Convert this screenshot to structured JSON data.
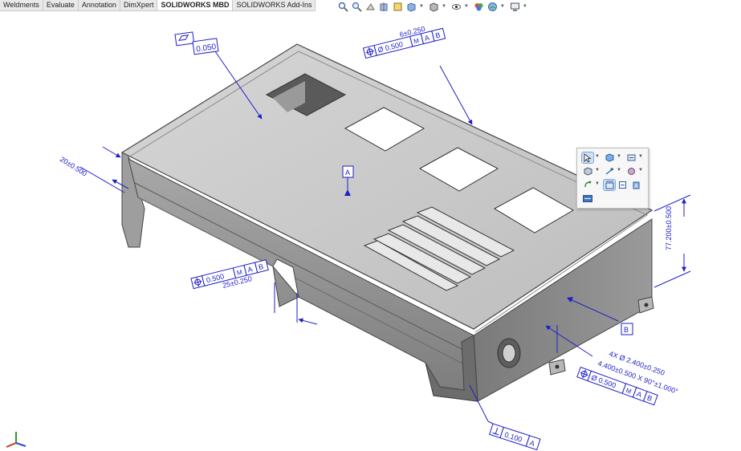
{
  "tabs": [
    {
      "label": "Weldments",
      "active": false
    },
    {
      "label": "Evaluate",
      "active": false
    },
    {
      "label": "Annotation",
      "active": false
    },
    {
      "label": "DimXpert",
      "active": false
    },
    {
      "label": "SOLIDWORKS MBD",
      "active": true
    },
    {
      "label": "SOLIDWORKS Add-Ins",
      "active": false
    }
  ],
  "heads_up_toolbar": [
    "zoom-to-fit-icon",
    "zoom-to-area-icon",
    "previous-view-icon",
    "section-view-icon",
    "dynamic-annotation-icon",
    "view-orientation-icon",
    "display-style-icon",
    "hide-show-items-icon",
    "edit-appearance-icon",
    "apply-scene-icon",
    "view-settings-icon"
  ],
  "annotations": {
    "flatness_tol": "0.050",
    "hole_pattern_qty": "6±0.250",
    "hole_pattern_pos_tol": "Ø 0.500",
    "hole_pattern_mod": "M",
    "hole_pattern_datum1": "A",
    "hole_pattern_datum2": "B",
    "side_dim": "20±0.500",
    "slot_qty": "25±0.250",
    "slot_pos_tol": "0.500",
    "slot_mod": "M",
    "slot_datum1": "A",
    "slot_datum2": "B",
    "height_dim": "77.200±0.500",
    "datum_a": "A",
    "datum_b": "B",
    "side_hole_line1": "4X Ø 2.400±0.250",
    "side_hole_line2": "4.400±0.500 X 90°±1.000°",
    "side_hole_pos_tol": "Ø 0.500",
    "side_hole_mod": "M",
    "side_hole_datum1": "A",
    "side_hole_datum2": "B",
    "perp_tol": "0.100",
    "perp_datum": "A"
  },
  "context_toolbar": [
    "select-icon",
    "datum-icon",
    "reference-dimension-icon",
    "box-view-icon",
    "smart-dimension-icon",
    "surface-finish-icon",
    "rotate-icon",
    "location-dimension-icon",
    "note-icon",
    "size-dimension-icon",
    "pattern-icon"
  ],
  "colors": {
    "annotation": "#1e1ec8",
    "model_top": "#c9c9c9",
    "model_side": "#8e8e8e",
    "model_dark": "#5c5c5c"
  }
}
